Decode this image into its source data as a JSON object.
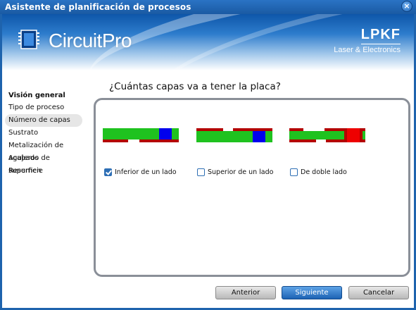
{
  "window": {
    "title": "Asistente de planificación de procesos",
    "close_label": "×"
  },
  "banner": {
    "product_name": "CircuitPro",
    "brand_name": "LPKF",
    "brand_subtitle": "Laser & Electronics",
    "icon": "circuit-chip-icon"
  },
  "sidebar": {
    "heading": "Visión general",
    "items": [
      {
        "label": "Tipo de proceso",
        "active": false
      },
      {
        "label": "Número de capas",
        "active": true
      },
      {
        "label": "Sustrato",
        "active": false
      },
      {
        "label": "Metalización de agujeros",
        "active": false
      },
      {
        "label": "Acabado de superficie",
        "active": false
      },
      {
        "label": "Resumen",
        "active": false
      }
    ]
  },
  "main": {
    "question": "¿Cuántas capas va a tener la placa?",
    "options": [
      {
        "label": "Inferior de un lado",
        "checked": true
      },
      {
        "label": "Superior de un lado",
        "checked": false
      },
      {
        "label": "De doble lado",
        "checked": false
      }
    ]
  },
  "buttons": {
    "back": "Anterior",
    "next": "Siguiente",
    "cancel": "Cancelar"
  },
  "colors": {
    "substrate": "#1fc21f",
    "copper": "#b30000",
    "via_bottom": "#0000ee",
    "via_both": "#ee0000",
    "accent": "#1c62b4"
  }
}
